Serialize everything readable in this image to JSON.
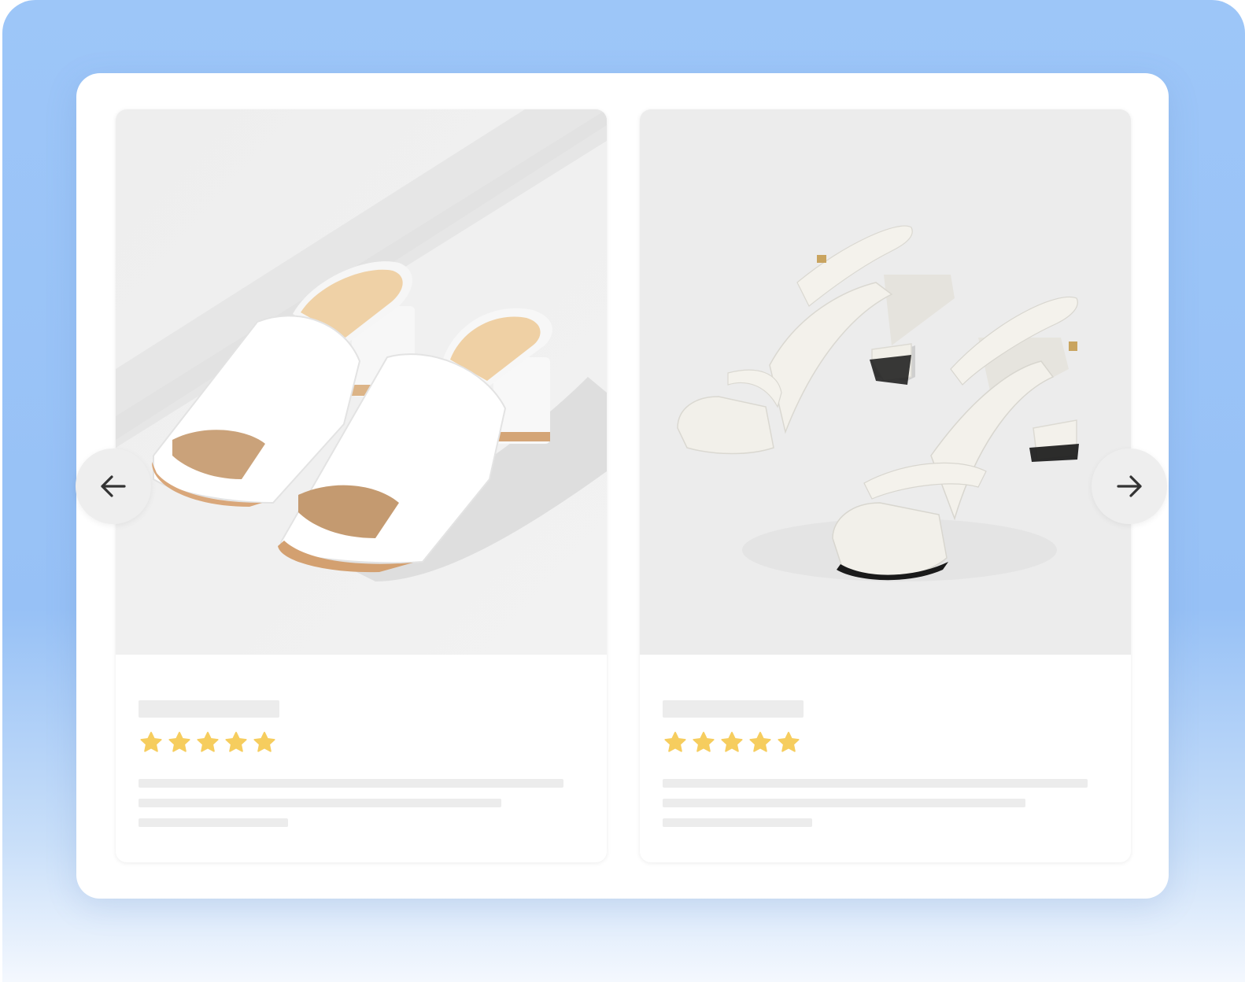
{
  "carousel": {
    "prev_icon": "arrow-left-icon",
    "next_icon": "arrow-right-icon",
    "products": [
      {
        "image": "white-block-heel-mule-sandals",
        "rating": 5
      },
      {
        "image": "white-strappy-block-heel-sandals",
        "rating": 5
      }
    ]
  },
  "colors": {
    "background_top": "#9dc6f8",
    "background_bottom": "#f4f8fe",
    "panel": "#ffffff",
    "skeleton": "#ececec",
    "star": "#f6cd5e",
    "nav_button": "#eeeeee",
    "nav_icon": "#333333"
  }
}
